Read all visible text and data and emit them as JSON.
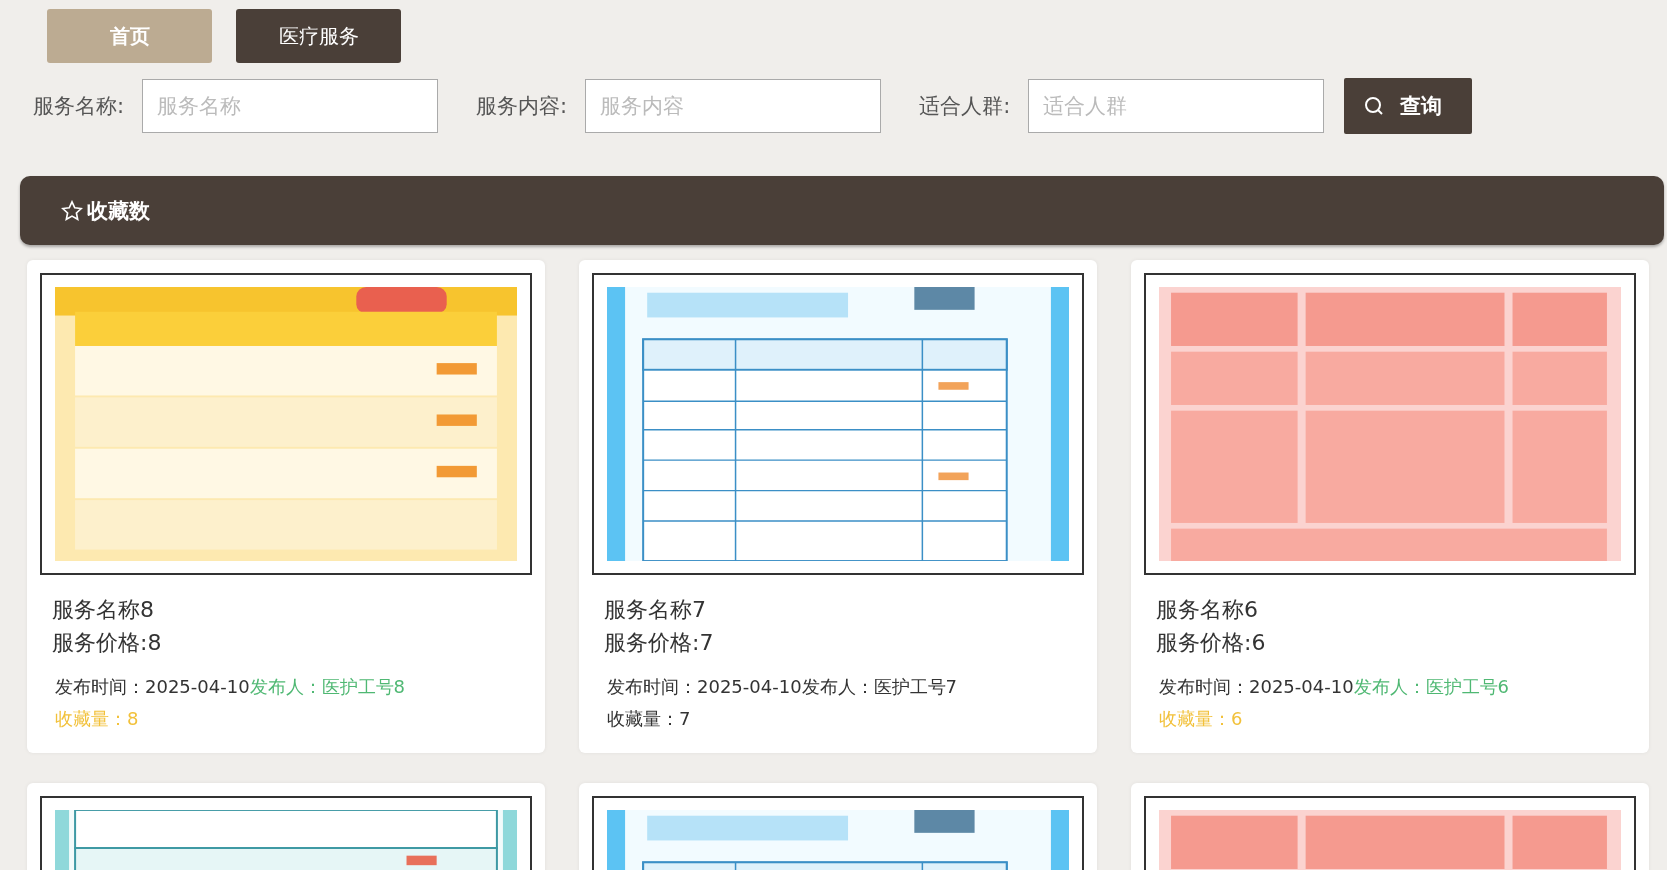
{
  "tabs": [
    {
      "label": "首页",
      "selected": true
    },
    {
      "label": "医疗服务",
      "selected": false
    }
  ],
  "search": {
    "fields": [
      {
        "label": "服务名称:",
        "placeholder": "服务名称"
      },
      {
        "label": "服务内容:",
        "placeholder": "服务内容"
      },
      {
        "label": "适合人群:",
        "placeholder": "适合人群"
      }
    ],
    "button": "查询"
  },
  "sort_bar": {
    "label": "收藏数"
  },
  "cards": [
    {
      "kind": "full",
      "name": "服务名称8",
      "price": "服务价格:8",
      "time": "发布时间：2025-04-10",
      "publisher": "发布人：医护工号8",
      "favorites": "收藏量：8",
      "hovered": false
    },
    {
      "kind": "full",
      "name": "服务名称7",
      "price": "服务价格:7",
      "time": "发布时间：2025-04-10",
      "publisher": "发布人：医护工号7",
      "favorites": "收藏量：7",
      "hovered": true
    },
    {
      "kind": "full",
      "name": "服务名称6",
      "price": "服务价格:6",
      "time": "发布时间：2025-04-10",
      "publisher": "发布人：医护工号6",
      "favorites": "收藏量：6",
      "hovered": false
    },
    {
      "kind": "picture"
    },
    {
      "kind": "picture"
    },
    {
      "kind": "picture"
    }
  ]
}
